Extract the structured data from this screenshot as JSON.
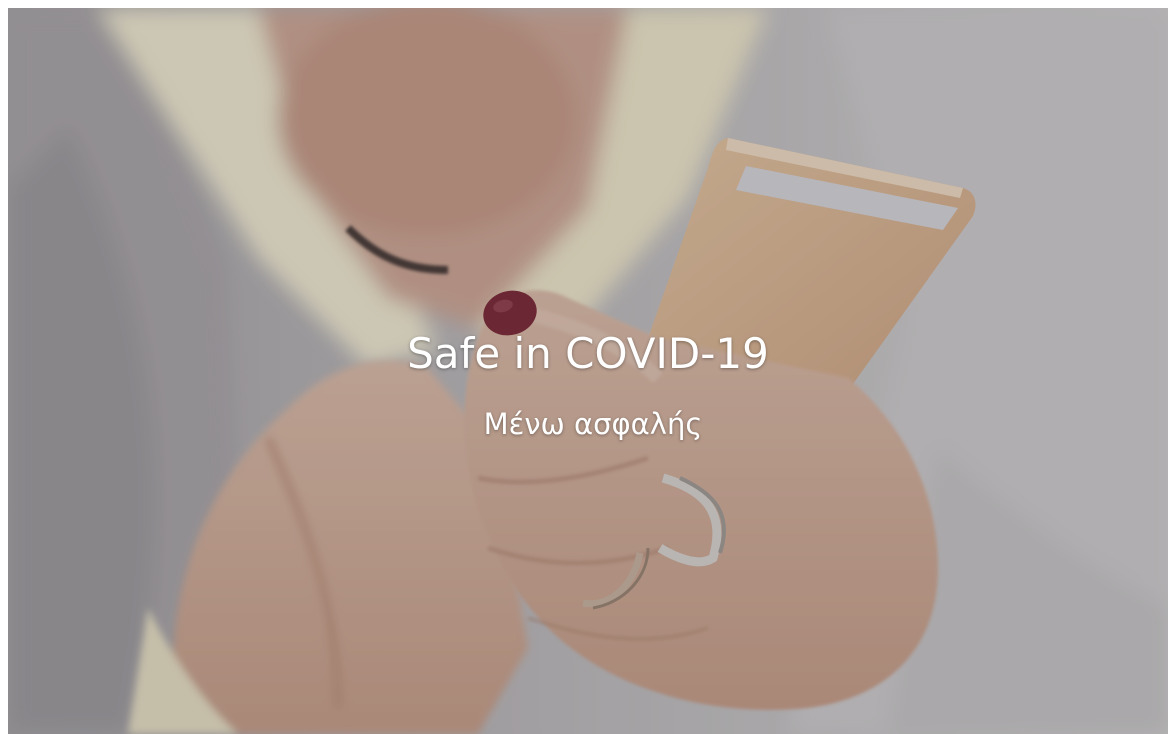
{
  "slide": {
    "title": "Safe in COVID-19",
    "subtitle": "Μένω ασφαλής"
  },
  "photo": {
    "subject": "hands-holding-smartphone-icon",
    "colors": {
      "sweater": "#c4c1c3",
      "collar": "#f3ecd3",
      "skin": "#d8b8a6",
      "phone": "#e0bf9c",
      "nail": "#7c2838"
    }
  }
}
